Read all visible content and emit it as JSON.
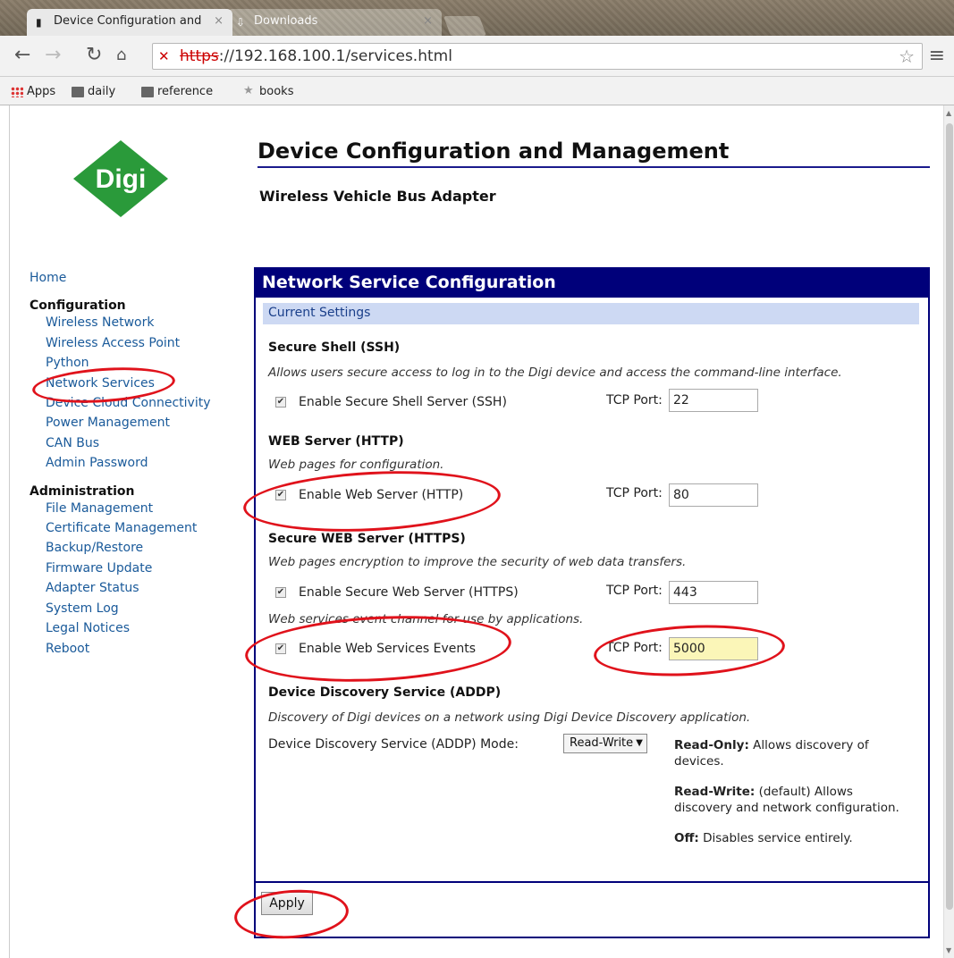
{
  "browser": {
    "tabs": [
      {
        "label": "Device Configuration and"
      },
      {
        "label": "Downloads"
      }
    ],
    "url_scheme": "https",
    "url_rest": "://192.168.100.1/services.html",
    "bookmarks": [
      "Apps",
      "daily",
      "reference",
      "books"
    ]
  },
  "header": {
    "logo_text": "Digi",
    "title": "Device Configuration and Management",
    "subtitle": "Wireless Vehicle Bus Adapter"
  },
  "sidebar": {
    "home": "Home",
    "config_heading": "Configuration",
    "config_items": [
      "Wireless Network",
      "Wireless Access Point",
      "Python",
      "Network Services",
      "Device Cloud Connectivity",
      "Power Management",
      "CAN Bus",
      "Admin Password"
    ],
    "admin_heading": "Administration",
    "admin_items": [
      "File Management",
      "Certificate Management",
      "Backup/Restore",
      "Firmware Update",
      "Adapter Status",
      "System Log",
      "Legal Notices",
      "Reboot"
    ]
  },
  "panel": {
    "title": "Network Service Configuration",
    "current_settings": "Current Settings",
    "tcp_label": "TCP Port:",
    "ssh": {
      "heading": "Secure Shell (SSH)",
      "desc": "Allows users secure access to log in to the Digi device and access the command-line interface.",
      "label": "Enable Secure Shell Server (SSH)",
      "port": "22"
    },
    "http": {
      "heading": "WEB Server (HTTP)",
      "desc": "Web pages for configuration.",
      "label": "Enable Web Server (HTTP)",
      "port": "80"
    },
    "https": {
      "heading": "Secure WEB Server (HTTPS)",
      "desc": "Web pages encryption to improve the security of web data transfers.",
      "label": "Enable Secure Web Server (HTTPS)",
      "port": "443"
    },
    "events": {
      "desc": "Web services event channel for use by applications.",
      "label": "Enable Web Services Events",
      "port": "5000"
    },
    "addp": {
      "heading": "Device Discovery Service (ADDP)",
      "desc": "Discovery of Digi devices on a network using Digi Device Discovery application.",
      "label": "Device Discovery Service (ADDP) Mode:",
      "selected": "Read-Write",
      "notes": [
        {
          "term": "Read-Only:",
          "text": " Allows discovery of devices."
        },
        {
          "term": "Read-Write:",
          "text": " (default) Allows discovery and network configuration."
        },
        {
          "term": "Off:",
          "text": " Disables service entirely."
        }
      ]
    },
    "apply": "Apply"
  },
  "colors": {
    "accent": "#00007a",
    "link": "#1a5a9a",
    "annotation": "#e0121b",
    "logo": "#2a9a3a"
  }
}
